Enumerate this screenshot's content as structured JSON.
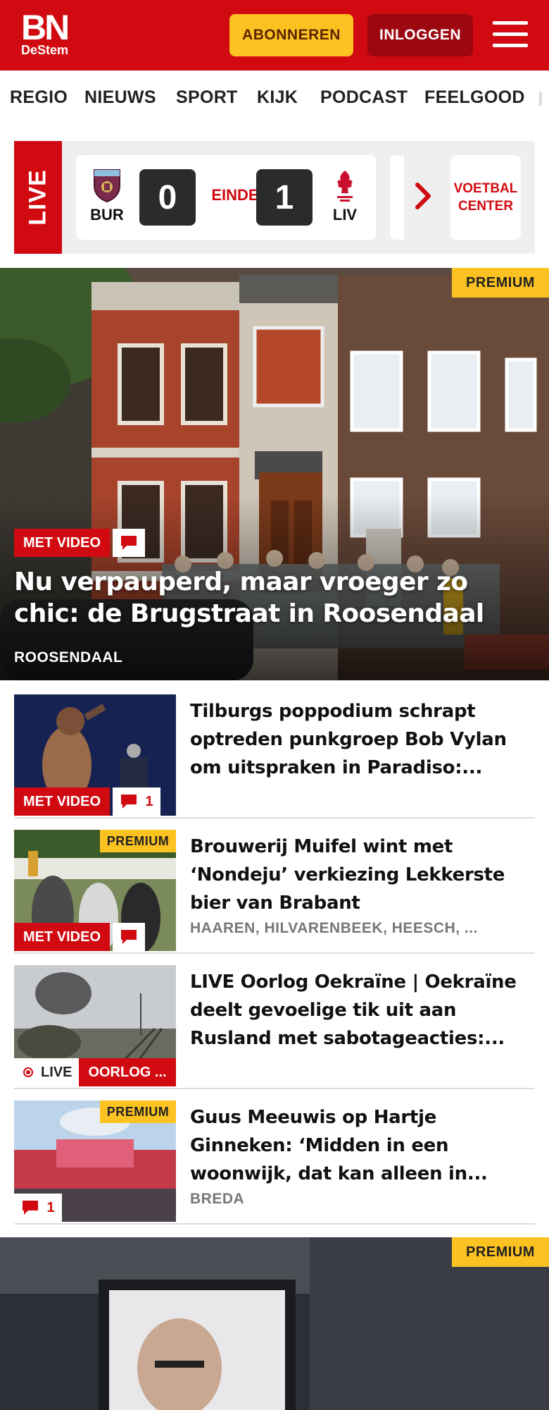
{
  "header": {
    "logo_main": "BN",
    "logo_sub": "DeStem",
    "subscribe_label": "ABONNEREN",
    "login_label": "INLOGGEN",
    "brand_color": "#d10a11",
    "accent_color": "#fcc221"
  },
  "nav": {
    "items": [
      "REGIO",
      "NIEUWS",
      "SPORT",
      "KIJK",
      "PODCAST",
      "FEELGOOD"
    ]
  },
  "live": {
    "tab_label": "LIVE",
    "home_team": "BUR",
    "away_team": "LIV",
    "home_score": "0",
    "away_score": "1",
    "status": "EINDE",
    "voetbal_center": "VOETBAL CENTER"
  },
  "hero": {
    "premium_label": "PREMIUM",
    "video_label": "MET VIDEO",
    "title": "Nu verpauperd, maar vroeger zo chic: de Brugstraat in Roosendaal",
    "location": "ROOSENDAAL"
  },
  "articles": [
    {
      "title": "Tilburgs poppodium schrapt optreden punkgroep Bob Vylan om uitspraken in Paradiso:...",
      "video_label": "MET VIDEO",
      "comments": "1"
    },
    {
      "title": "Brouwerij Muifel wint met ‘Nondeju’ verkiezing Lekkerste bier van Brabant",
      "location": "HAAREN, HILVARENBEEK, HEESCH, ...",
      "premium_label": "PREMIUM",
      "video_label": "MET VIDEO"
    },
    {
      "title": "LIVE Oorlog Oekraïne | Oekraïne deelt gevoelige tik uit aan Rusland met sabotageacties:...",
      "live_label": "LIVE",
      "tag_label": "OORLOG ..."
    },
    {
      "title": "Guus Meeuwis op Hartje Ginneken: ‘Midden in een woonwijk, dat kan alleen in...",
      "location": "BREDA",
      "premium_label": "PREMIUM",
      "comments": "1"
    }
  ],
  "hero2": {
    "premium_label": "PREMIUM"
  }
}
